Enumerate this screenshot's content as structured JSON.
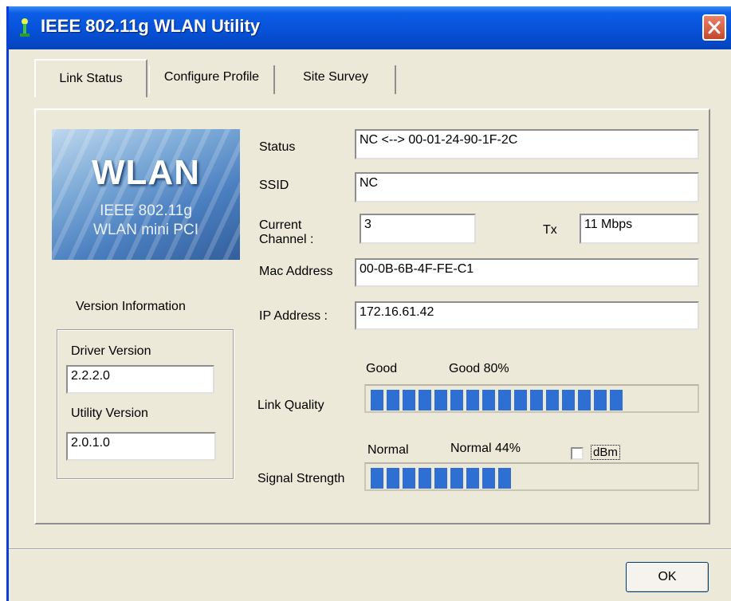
{
  "window": {
    "title": "IEEE 802.11g WLAN Utility"
  },
  "tabs": [
    {
      "label": "Link Status",
      "active": true
    },
    {
      "label": "Configure Profile",
      "active": false
    },
    {
      "label": "Site Survey",
      "active": false
    }
  ],
  "logo": {
    "title": "WLAN",
    "line1": "IEEE 802.11g",
    "line2": "WLAN mini PCI"
  },
  "version": {
    "heading": "Version Information",
    "driver_label": "Driver Version",
    "driver_value": "2.2.2.0",
    "utility_label": "Utility Version",
    "utility_value": "2.0.1.0"
  },
  "status": {
    "status_label": "Status",
    "status_value": "NC <--> 00-01-24-90-1F-2C",
    "ssid_label": "SSID",
    "ssid_value": "NC",
    "channel_label": "Current Channel :",
    "channel_value": "3",
    "tx_label": "Tx",
    "tx_value": "11 Mbps",
    "mac_label": "Mac Address",
    "mac_value": "00-0B-6B-4F-FE-C1",
    "ip_label": "IP Address :",
    "ip_value": "172.16.61.42"
  },
  "link_quality": {
    "label": "Link Quality",
    "level_text": "Good",
    "detail_text": "Good 80%",
    "percent": 80
  },
  "signal_strength": {
    "label": "Signal Strength",
    "level_text": "Normal",
    "detail_text": "Normal 44%",
    "percent": 44,
    "dbm_label": "dBm",
    "dbm_checked": false
  },
  "buttons": {
    "ok_label": "OK"
  },
  "colors": {
    "titlebar": "#0650d6",
    "meter_fill": "#2e6fd4",
    "close_button": "#c9462a"
  }
}
